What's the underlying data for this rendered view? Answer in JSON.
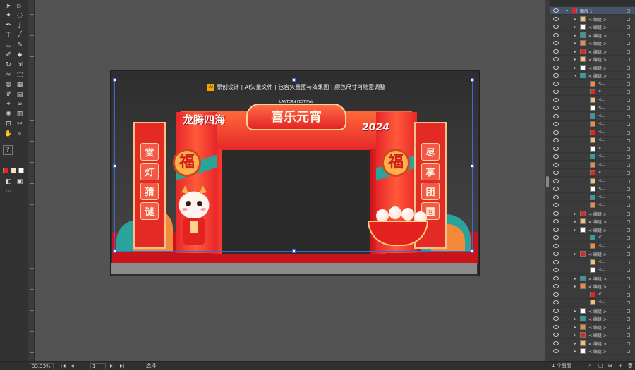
{
  "toolbar": {
    "tools": [
      "selection-tool",
      "direct-selection-tool",
      "magic-wand-tool",
      "lasso-tool",
      "pen-tool",
      "curvature-tool",
      "type-tool",
      "line-segment-tool",
      "rectangle-tool",
      "paintbrush-tool",
      "shaper-tool",
      "eraser-tool",
      "rotate-tool",
      "scale-tool",
      "width-tool",
      "free-transform-tool",
      "shape-builder-tool",
      "perspective-grid-tool",
      "mesh-tool",
      "gradient-tool",
      "eyedropper-tool",
      "blend-tool",
      "symbol-sprayer-tool",
      "column-graph-tool",
      "artboard-tool",
      "slice-tool",
      "hand-tool",
      "zoom-tool"
    ],
    "help_label": "?",
    "fill_color": "#e42424",
    "stroke_color": "#ffffff"
  },
  "artwork": {
    "banner_text": "原创设计 | AI矢量文件 | 包含矢量图与效果图 | 颜色尺寸可随意调整",
    "ai_badge": "Ai",
    "main_title": "喜乐元宵",
    "sub_title": "LANTERN FESTIVAL",
    "slogan": "龙腾四海",
    "year": "2024",
    "fu_char": "福",
    "left_panel": [
      "赏",
      "灯",
      "猜",
      "谜"
    ],
    "right_panel": [
      "尽",
      "享",
      "团",
      "圆"
    ]
  },
  "layers_panel": {
    "top_layer": "图层 1",
    "group_label": "< 编组 >",
    "path_label": "<..."
  },
  "status_bar": {
    "zoom": "33.33%",
    "artboard_number": "1",
    "tool_name": "选择",
    "layer_count": "1 个图层"
  },
  "colors": {
    "brand_red": "#e42424",
    "teal": "#2aa39a",
    "gold": "#ffd28f",
    "selection_blue": "#3a6ad6"
  }
}
